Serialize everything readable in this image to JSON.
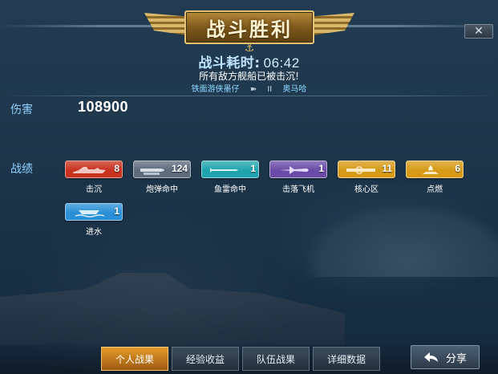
{
  "header": {
    "title": "战斗胜利",
    "timer_label": "战斗耗时:",
    "timer_value": "06:42",
    "subtitle": "所有敌方舰船已被击沉!",
    "player_left": "铁面游侠墨仔",
    "vs_mark": "II",
    "player_right": "奥马哈",
    "close_symbol": "✕"
  },
  "damage": {
    "label": "伤害",
    "value": "108900"
  },
  "record": {
    "label": "战绩",
    "items": [
      {
        "name": "击沉",
        "count": "8",
        "color": "#c8321e",
        "icon": "warship-icon"
      },
      {
        "name": "炮弹命中",
        "count": "124",
        "color": "#5c6a7c",
        "icon": "shell-icon"
      },
      {
        "name": "鱼雷命中",
        "count": "1",
        "color": "#1fa4ad",
        "icon": "torpedo-icon"
      },
      {
        "name": "击落飞机",
        "count": "1",
        "color": "#6a4ca8",
        "icon": "aircraft-icon"
      },
      {
        "name": "核心区",
        "count": "11",
        "color": "#d69a17",
        "icon": "citadel-icon"
      },
      {
        "name": "点燃",
        "count": "6",
        "color": "#d69a17",
        "icon": "fire-icon"
      },
      {
        "name": "进水",
        "count": "1",
        "color": "#2a8fd6",
        "icon": "flooding-icon"
      }
    ]
  },
  "tabs": [
    {
      "label": "个人战果",
      "active": true
    },
    {
      "label": "经验收益",
      "active": false
    },
    {
      "label": "队伍战果",
      "active": false
    },
    {
      "label": "详细数据",
      "active": false
    }
  ],
  "share_button": {
    "label": "分享",
    "icon": "share-icon"
  }
}
